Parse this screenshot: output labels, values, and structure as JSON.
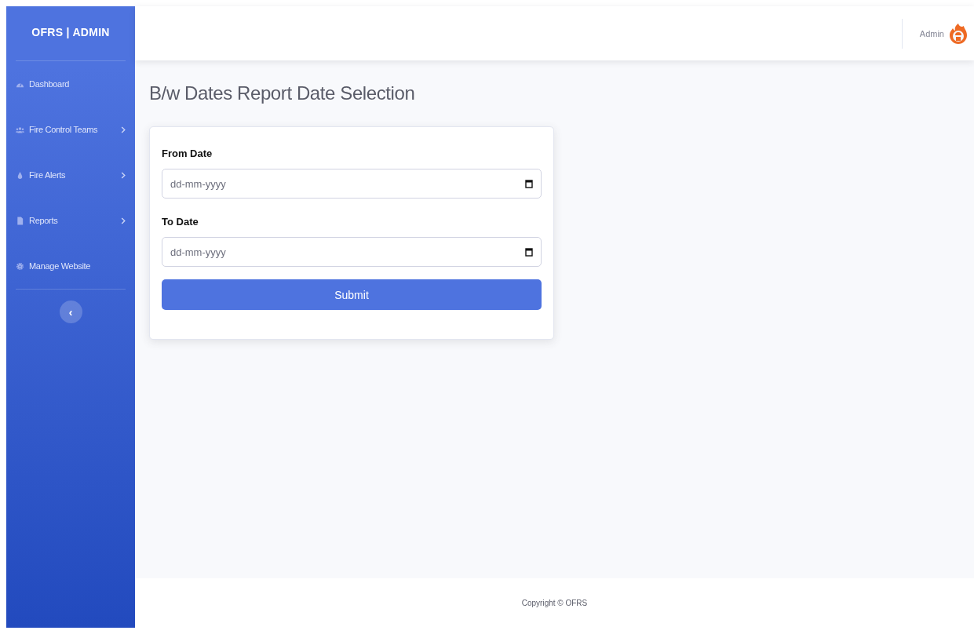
{
  "sidebar": {
    "brand": "OFRS | ADMIN",
    "items": [
      {
        "label": "Dashboard",
        "expandable": false
      },
      {
        "label": "Fire Control Teams",
        "expandable": true
      },
      {
        "label": "Fire Alerts",
        "expandable": true
      },
      {
        "label": "Reports",
        "expandable": true
      },
      {
        "label": "Manage Website",
        "expandable": false
      }
    ],
    "toggle": "‹"
  },
  "topbar": {
    "user": "Admin"
  },
  "page_title": "B/w Dates Report Date Selection",
  "form": {
    "fields": [
      {
        "label": "From Date",
        "placeholder": "dd-mm-yyyy"
      },
      {
        "label": "To Date",
        "placeholder": "dd-mm-yyyy"
      }
    ],
    "submit": "Submit"
  },
  "footer": "Copyright © OFRS"
}
